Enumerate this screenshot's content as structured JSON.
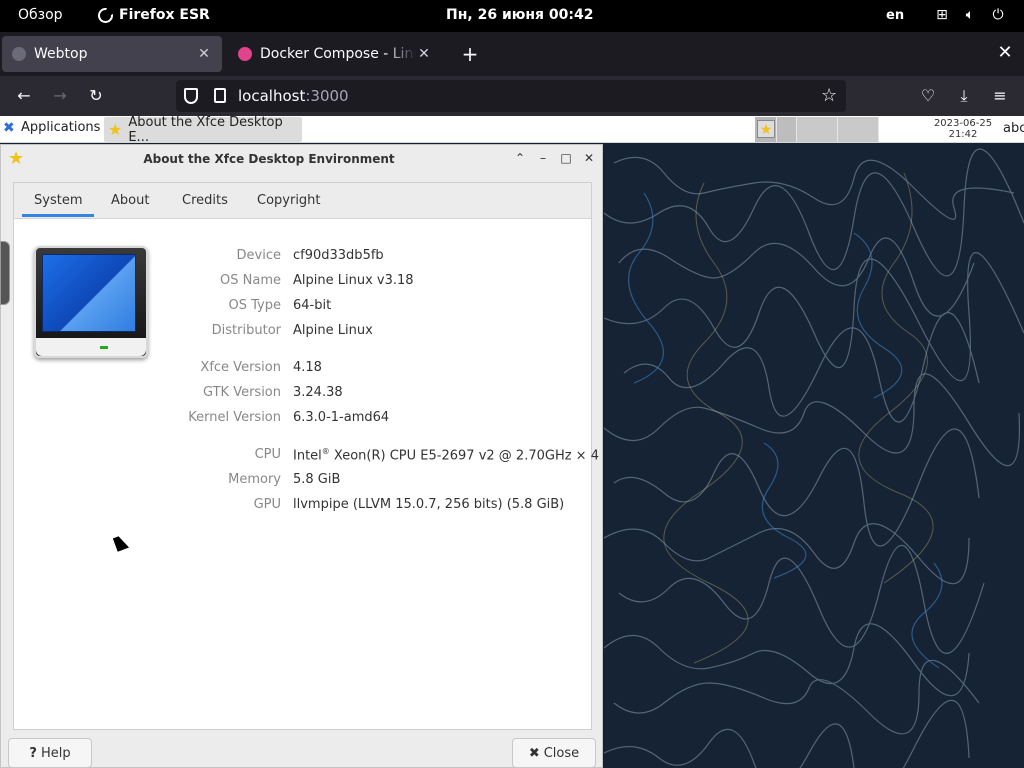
{
  "topbar": {
    "overview": "Обзор",
    "app_name": "Firefox ESR",
    "clock": "Пн, 26 июня  00:42",
    "language": "en",
    "tray_icons": [
      "network-icon",
      "volume-icon",
      "power-icon"
    ]
  },
  "browser": {
    "tabs": [
      {
        "title": "Webtop",
        "active": true
      },
      {
        "title": "Docker Compose - LinuxServer",
        "active": false
      }
    ],
    "url_host": "localhost",
    "url_port": ":3000"
  },
  "xfce_panel": {
    "applications_label": "Applications",
    "applications_suffix": "⋮",
    "task_button_label": "About the Xfce Desktop E...",
    "clock_date": "2023-06-25",
    "clock_time": "21:42",
    "keyboard_layout": "abc"
  },
  "dialog": {
    "title": "About the Xfce Desktop Environment",
    "tabs": [
      "System",
      "About",
      "Credits",
      "Copyright"
    ],
    "active_tab": "System",
    "rows": [
      {
        "label": "Device",
        "value": "cf90d33db5fb"
      },
      {
        "label": "OS Name",
        "value": "Alpine Linux v3.18"
      },
      {
        "label": "OS Type",
        "value": "64-bit"
      },
      {
        "label": "Distributor",
        "value": "Alpine Linux"
      },
      {
        "label": "Xfce Version",
        "value": "4.18"
      },
      {
        "label": "GTK Version",
        "value": "3.24.38"
      },
      {
        "label": "Kernel Version",
        "value": "6.3.0-1-amd64"
      },
      {
        "label": "CPU",
        "value_pre": "Intel",
        "value_sup": "®",
        "value_post": " Xeon(R) CPU E5-2697 v2 @ 2.70GHz × 4"
      },
      {
        "label": "Memory",
        "value": "5.8 GiB"
      },
      {
        "label": "GPU",
        "value": "llvmpipe (LLVM 15.0.7, 256 bits) (5.8 GiB)"
      }
    ],
    "help_label": "Help",
    "close_label": "Close"
  },
  "colors": {
    "accent": "#3584e4",
    "firefox_tabstrip": "#1c1b22",
    "firefox_nav": "#2b2a33",
    "wallpaper": "#152334"
  }
}
